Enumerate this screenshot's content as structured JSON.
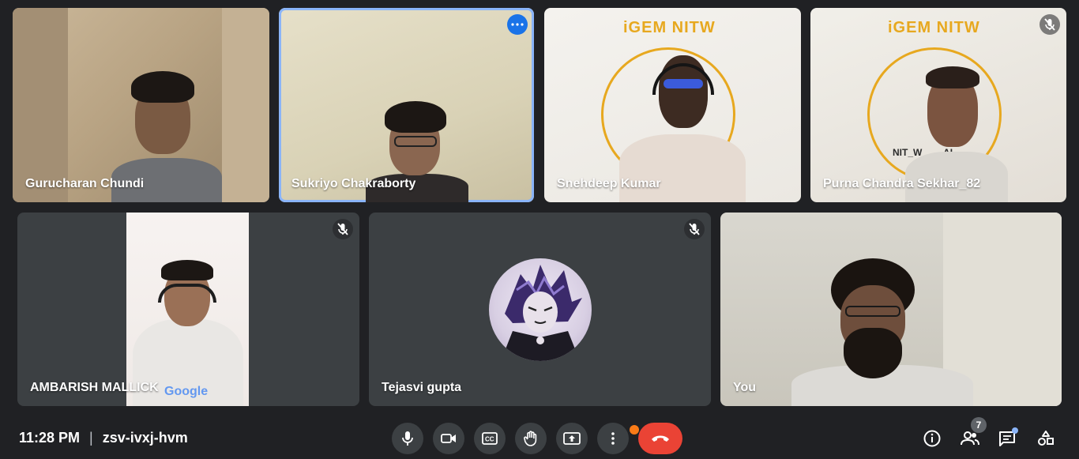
{
  "participants": [
    {
      "name": "Gurucharan Chundi"
    },
    {
      "name": "Sukriyo Chakraborty"
    },
    {
      "name": "Snehdeep Kumar",
      "logo": "iGEM NITW"
    },
    {
      "name": "Purna Chandra Sekhar_82",
      "logo": "iGEM NITW",
      "logo_sub": "NIT_W____AL",
      "muted": true
    },
    {
      "name": "AMBARISH MALLICK",
      "muted": true,
      "shirt_text": "Google"
    },
    {
      "name": "Tejasvi gupta",
      "muted": true,
      "avatar_icon": "profile-picture"
    },
    {
      "name": "You"
    }
  ],
  "meeting": {
    "time": "11:28 PM",
    "separator": "|",
    "code": "zsv-ivxj-hvm"
  },
  "controls": {
    "items": [
      "mic-icon",
      "camera-icon",
      "captions-icon",
      "raise-hand-icon",
      "present-icon",
      "more-options-icon",
      "end-call-icon"
    ]
  },
  "right_panel": {
    "people_count": "7",
    "icons": [
      "info-icon",
      "people-icon",
      "chat-icon",
      "activities-icon"
    ]
  },
  "colors": {
    "background": "#202124",
    "tile": "#3c4043",
    "end_call": "#ea4335",
    "active_outline": "#8ab4f8",
    "notification": "#fa7b17",
    "logo_gold": "#e7a81f"
  }
}
